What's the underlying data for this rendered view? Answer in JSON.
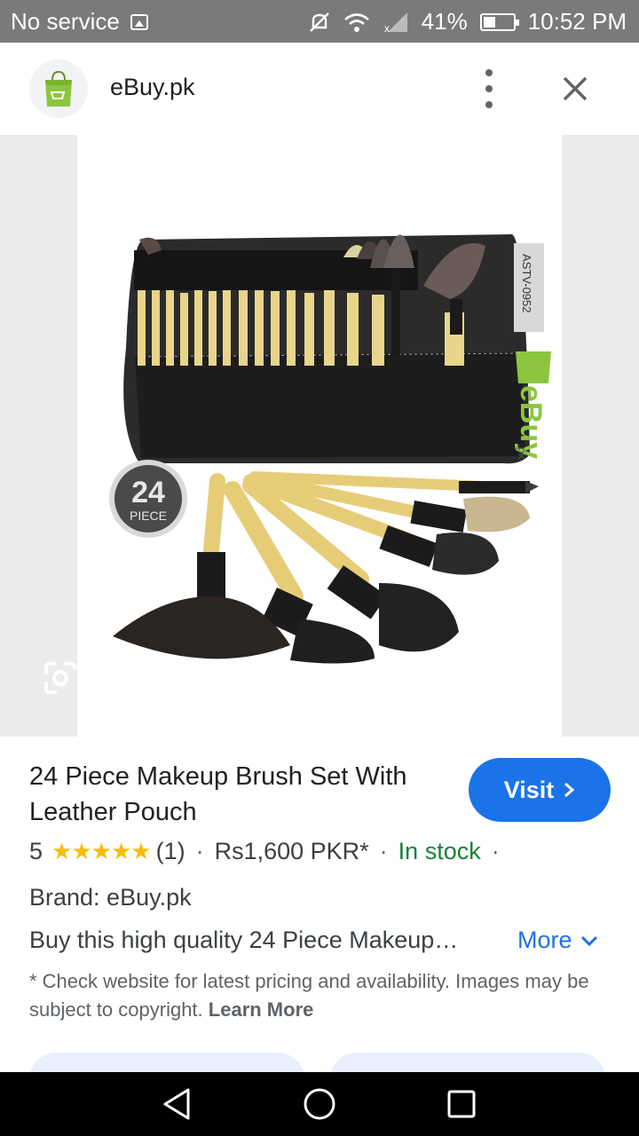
{
  "status_bar": {
    "carrier": "No service",
    "battery": "41%",
    "time": "10:52 PM",
    "battery_level": 0.41
  },
  "header": {
    "site_name": "eBuy.pk",
    "icons": [
      "shopping-bag-logo-icon",
      "more-vert-icon",
      "close-icon"
    ]
  },
  "image": {
    "watermark_code": "ASTV-0952",
    "badge_number": "24",
    "badge_text": "PIECE",
    "watermark_brand": "eBuy",
    "watermark_tld": ".pk",
    "lens_icon": "google-lens-icon"
  },
  "product": {
    "title": "24 Piece Makeup Brush Set With Leather Pouch",
    "rating": "5",
    "stars": "★★★★★",
    "review_count": "(1)",
    "price": "Rs1,600 PKR*",
    "stock": "In stock",
    "brand": "Brand: eBuy.pk",
    "description": "Buy this high quality 24 Piece Makeup…",
    "more_label": "More",
    "visit_label": "Visit"
  },
  "disclaimer": {
    "text": "* Check website for latest pricing and availability. Images may be subject to copyright. ",
    "learn_more": "Learn More"
  },
  "colors": {
    "accent": "#1a73e8",
    "stock_green": "#188038",
    "star": "#fbbc04",
    "status_bar": "#7a7a7a"
  }
}
